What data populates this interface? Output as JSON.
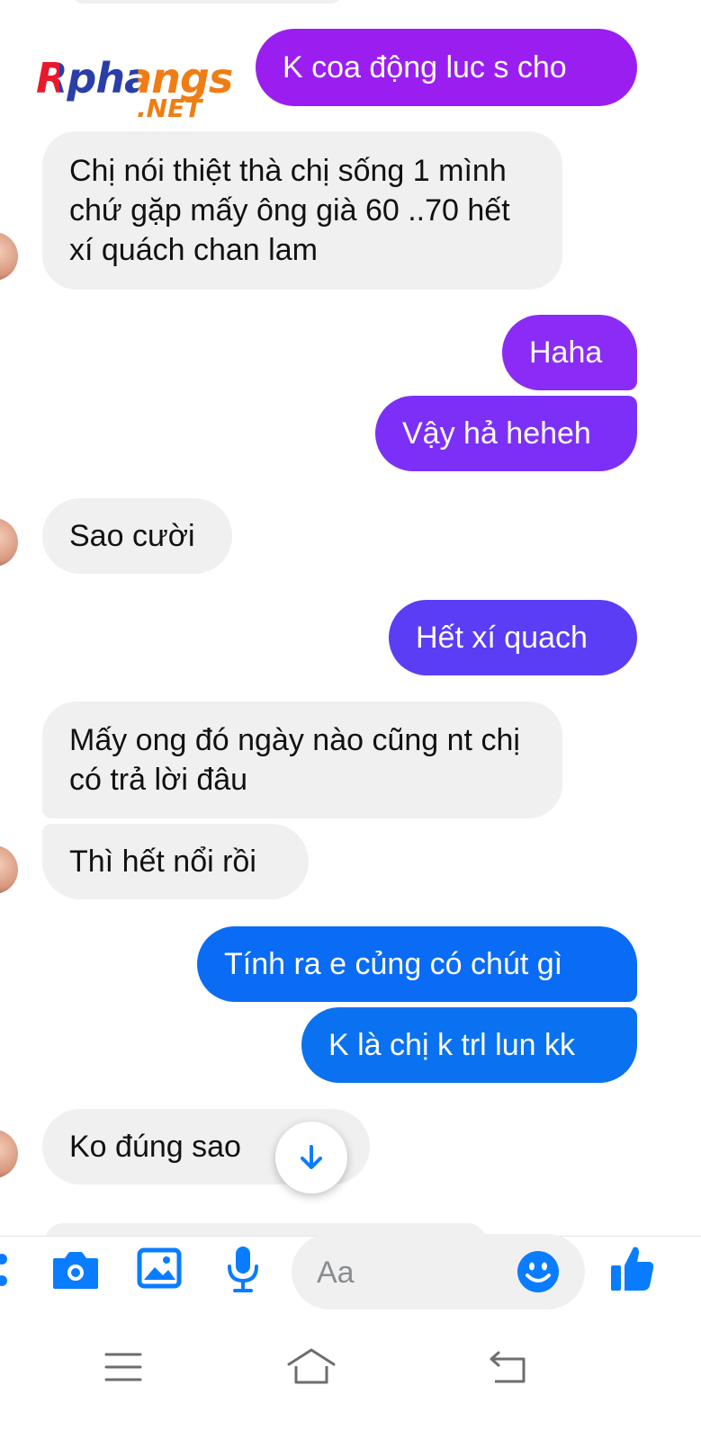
{
  "watermark": {
    "brand": "Rphangs",
    "domain": ".NET"
  },
  "messages": [
    {
      "id": 1,
      "side": "out",
      "text": "K coa động luc s cho",
      "color": "#9b1ef0"
    },
    {
      "id": 2,
      "side": "in",
      "text": "Chị nói thiệt thà chị sống 1 mình chứ gặp mấy ông già 60 ..70 hết xí quách chan lam"
    },
    {
      "id": 3,
      "side": "out",
      "text": "Haha",
      "color": "#8a2cf5"
    },
    {
      "id": 4,
      "side": "out",
      "text": "Vậy hả heheh",
      "color": "#7c30f7"
    },
    {
      "id": 5,
      "side": "in",
      "text": "Sao cười"
    },
    {
      "id": 6,
      "side": "out",
      "text": "Hết xí quach",
      "color": "#5a3df5"
    },
    {
      "id": 7,
      "side": "in",
      "text": "Mấy ong đó ngày nào cũng nt chị có trả lời đâu"
    },
    {
      "id": 8,
      "side": "in",
      "text": "Thì hết nổi rồi"
    },
    {
      "id": 9,
      "side": "out",
      "text": "Tính ra e củng có chút gì",
      "color": "#0a6cf5"
    },
    {
      "id": 10,
      "side": "out",
      "text": "K là chị k trl lun kk",
      "color": "#0a72f0"
    },
    {
      "id": 11,
      "side": "in",
      "text": "Ko đúng sao"
    }
  ],
  "composer": {
    "placeholder": "Aa",
    "icons": [
      "more-icon",
      "camera-icon",
      "gallery-icon",
      "microphone-icon",
      "emoji-icon",
      "like-icon"
    ],
    "accent": "#0a7cff"
  },
  "navbar": {
    "icons": [
      "menu-icon",
      "home-icon",
      "back-icon"
    ]
  },
  "colors": {
    "incoming_bubble": "#f0f0f0",
    "accent": "#0a7cff"
  }
}
